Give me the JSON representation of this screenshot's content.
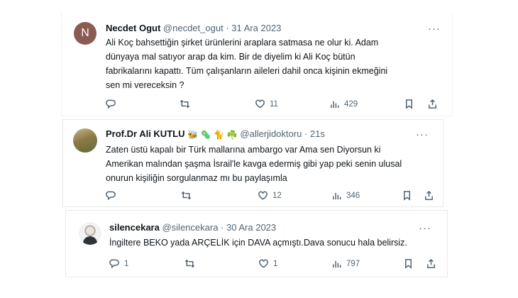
{
  "tweets": [
    {
      "avatar_letter": "N",
      "name": "Necdet Ogut",
      "handle": "@necdet_ogut",
      "separator": "·",
      "time": "31 Ara 2023",
      "lines": [
        "Ali Koç bahsettiğin şirket ürünlerini araplara satmasa ne olur ki. Adam",
        "dünyaya mal satıyor arap da kim. Bir de diyelim ki Ali Koç bütün",
        "fabrikalarını kapattı. Tüm çalışanların aileleri dahil onca kişinin ekmeğini",
        "sen mi vereceksin ?"
      ],
      "more": "···",
      "replies": "",
      "retweets": "",
      "likes": "11",
      "views": "429"
    },
    {
      "name": "Prof.Dr Ali KUTLU",
      "emojis": [
        "🐝",
        "🦠",
        "🐈",
        "☘️"
      ],
      "handle": "@allerjidoktoru",
      "separator": "·",
      "time": "21s",
      "lines": [
        "Zaten üstü kapalı bir Türk mallarına ambargo var Ama sen Diyorsun ki",
        "Amerikan malından şaşma İsrail'le kavga edermiş gibi yap peki senin ulusal",
        "onurun kişiliğin sorgulanmaz mı bu paylaşımla"
      ],
      "more": "···",
      "replies": "",
      "retweets": "",
      "likes": "12",
      "views": "346"
    },
    {
      "name": "silencekara",
      "handle": "@silencekara",
      "separator": "·",
      "time": "30 Ara 2023",
      "lines": [
        "İngiltere BEKO yada ARÇELİK için DAVA açmıştı.Dava sonucu hala belirsiz."
      ],
      "more": "···",
      "replies": "1",
      "retweets": "",
      "likes": "1",
      "views": "797"
    }
  ],
  "colors": {
    "text": "#0f1419",
    "muted": "#536471",
    "border": "#e6e9ea"
  },
  "icons": [
    "reply-icon",
    "retweet-icon",
    "like-icon",
    "views-icon",
    "bookmark-icon",
    "share-icon"
  ]
}
